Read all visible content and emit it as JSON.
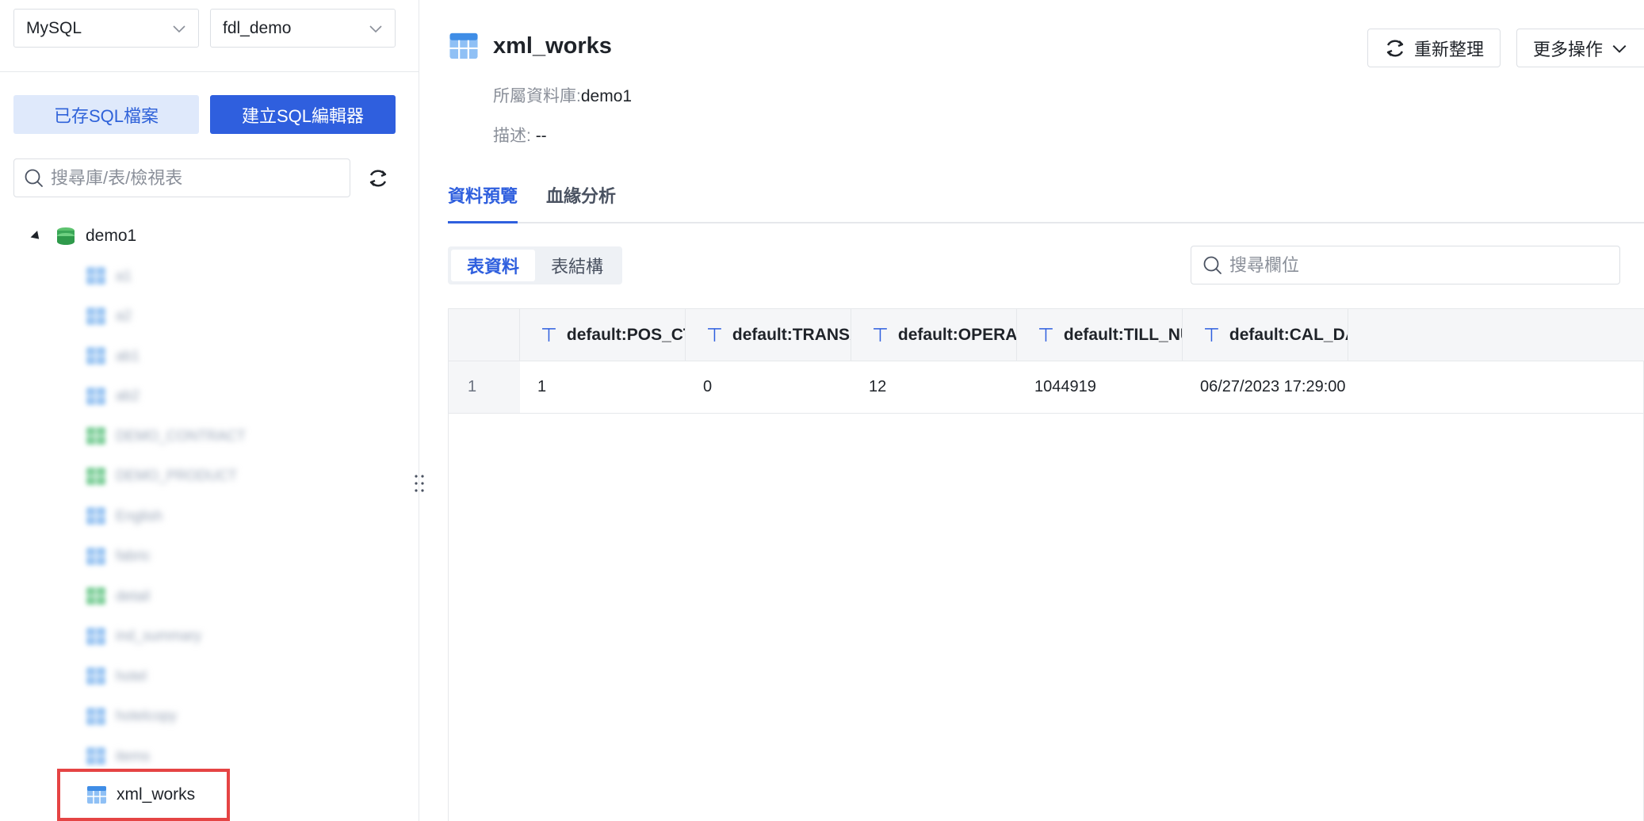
{
  "left": {
    "db_type": "MySQL",
    "db_name": "fdl_demo",
    "saved_sql_label": "已存SQL檔案",
    "new_sql_label": "建立SQL編輯器",
    "search_placeholder": "搜尋庫/表/檢視表",
    "tree": {
      "root_label": "demo1",
      "items": [
        {
          "label": "a1",
          "kind": "table"
        },
        {
          "label": "a2",
          "kind": "table"
        },
        {
          "label": "ab1",
          "kind": "table"
        },
        {
          "label": "ab2",
          "kind": "table"
        },
        {
          "label": "DEMO_CONTRACT",
          "kind": "view"
        },
        {
          "label": "DEMO_PRODUCT",
          "kind": "view"
        },
        {
          "label": "English",
          "kind": "table"
        },
        {
          "label": "fabric",
          "kind": "table"
        },
        {
          "label": "detail",
          "kind": "view"
        },
        {
          "label": "ind_summary",
          "kind": "table"
        },
        {
          "label": "hotel",
          "kind": "table"
        },
        {
          "label": "hotelcopy",
          "kind": "table"
        },
        {
          "label": "items",
          "kind": "table"
        }
      ],
      "selected_label": "xml_works"
    }
  },
  "right": {
    "title": "xml_works",
    "db_label": "所屬資料庫:",
    "db_value": "demo1",
    "desc_label": "描述:",
    "desc_value": "--",
    "refresh_label": "重新整理",
    "more_label": "更多操作",
    "tabs": [
      "資料預覽",
      "血緣分析"
    ],
    "subtabs": [
      "表資料",
      "表結構"
    ],
    "field_search_placeholder": "搜尋欄位",
    "columns": [
      "default:POS_CTRL",
      "default:TRANSA...",
      "default:OPERAT...",
      "default:TILL_NU...",
      "default:CAL_DA..."
    ],
    "rows": [
      {
        "index": "1",
        "cells": [
          "1",
          "0",
          "12",
          "1044919",
          "06/27/2023 17:29:00"
        ]
      }
    ]
  },
  "colors": {
    "primary": "#2f5fde",
    "primary_light": "#dfe9fb",
    "highlight": "#e54444",
    "db_icon_green": "#3aa757",
    "table_icon_blue": "#4a90e2"
  }
}
